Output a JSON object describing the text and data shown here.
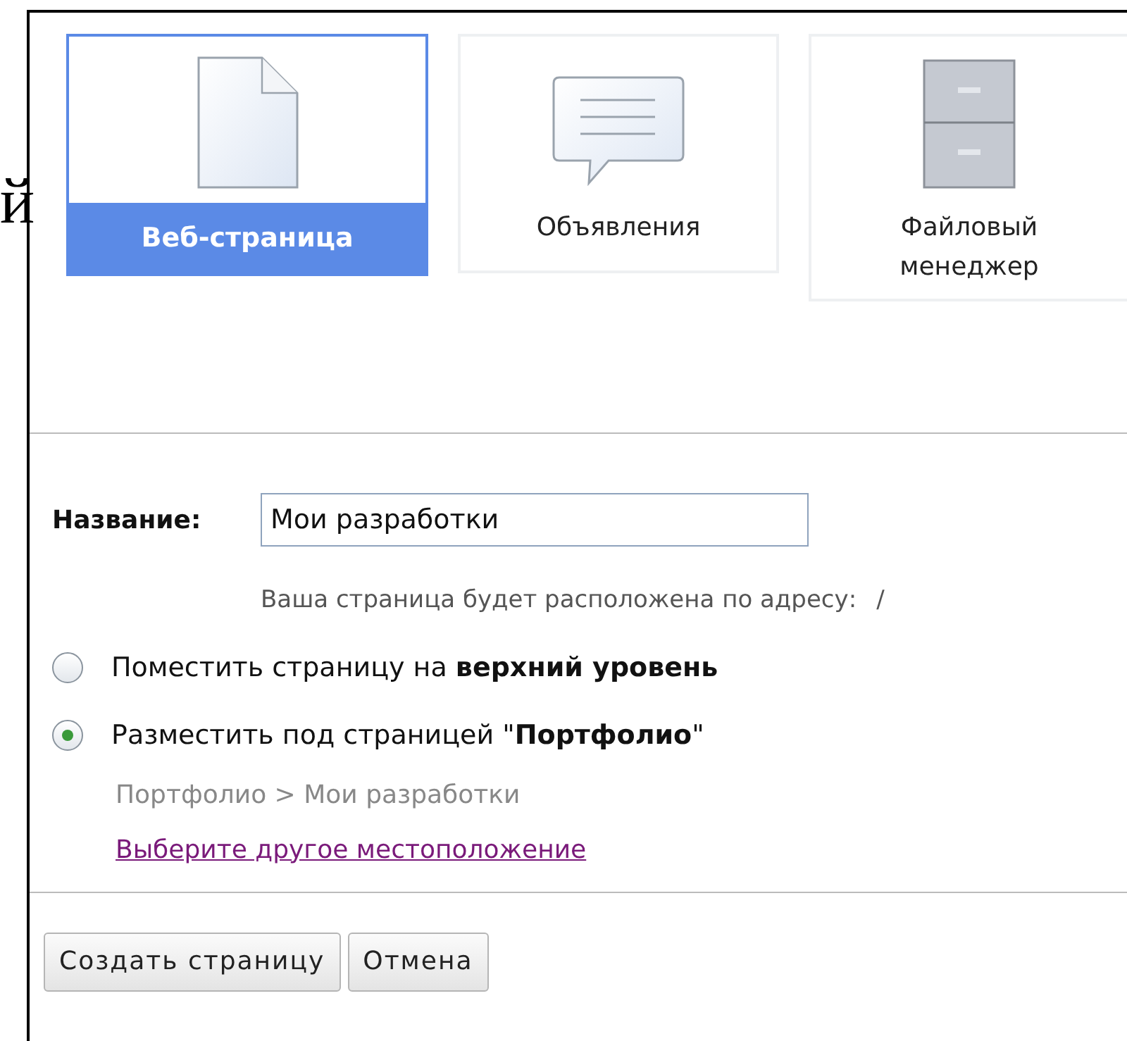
{
  "side_fragment": "й",
  "page_types": [
    {
      "label": "Веб-страница",
      "kind": "page",
      "selected": true
    },
    {
      "label": "Объявления",
      "kind": "message",
      "selected": false
    },
    {
      "label": "Файловый менеджер",
      "kind": "cabinet",
      "selected": false
    }
  ],
  "name_field": {
    "label": "Название:",
    "value": "Мои разработки"
  },
  "address_hint": {
    "text": "Ваша страница будет расположена по адресу:",
    "path": "/"
  },
  "placement": [
    {
      "label": "Поместить страницу на **верхний уровень**",
      "selected": false
    },
    {
      "label": "Разместить под страницей \"**Портфолио**\"",
      "selected": true
    }
  ],
  "breadcrumb": "Портфолио > Мои разработки",
  "change_location_link": "Выберите другое местоположение",
  "buttons": [
    "Создать страницу",
    "Отмена"
  ]
}
